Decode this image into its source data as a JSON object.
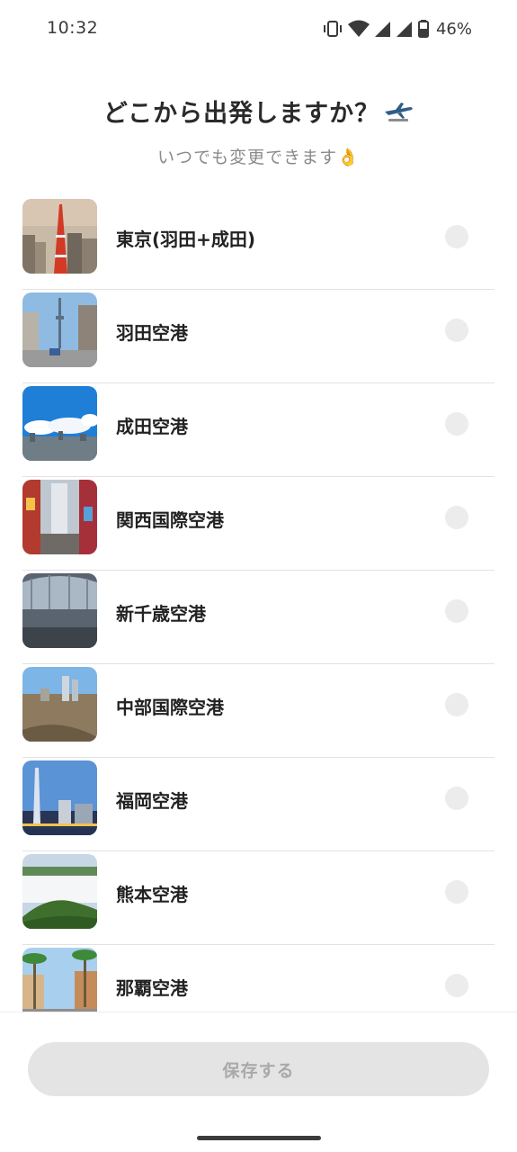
{
  "status_bar": {
    "time": "10:32",
    "battery_percent": "46%",
    "icons": [
      "vibrate-icon",
      "wifi-icon",
      "signal-icon",
      "signal-icon",
      "battery-icon"
    ]
  },
  "header": {
    "title": "どこから出発しますか？",
    "title_icon": "airplane-icon",
    "subtitle": "いつでも変更できます👌"
  },
  "airports": [
    {
      "label": "東京(羽田+成田)",
      "selected": false,
      "image": "tokyo-tower-photo"
    },
    {
      "label": "羽田空港",
      "selected": false,
      "image": "skytree-street-photo"
    },
    {
      "label": "成田空港",
      "selected": false,
      "image": "sky-city-photo"
    },
    {
      "label": "関西国際空港",
      "selected": false,
      "image": "osaka-street-photo"
    },
    {
      "label": "新千歳空港",
      "selected": false,
      "image": "airport-terminal-photo"
    },
    {
      "label": "中部国際空港",
      "selected": false,
      "image": "nagoya-city-photo"
    },
    {
      "label": "福岡空港",
      "selected": false,
      "image": "fukuoka-tower-photo"
    },
    {
      "label": "熊本空港",
      "selected": false,
      "image": "mountain-clouds-photo"
    },
    {
      "label": "那覇空港",
      "selected": false,
      "image": "palm-street-photo"
    }
  ],
  "save_button": {
    "label": "保存する",
    "enabled": false
  }
}
